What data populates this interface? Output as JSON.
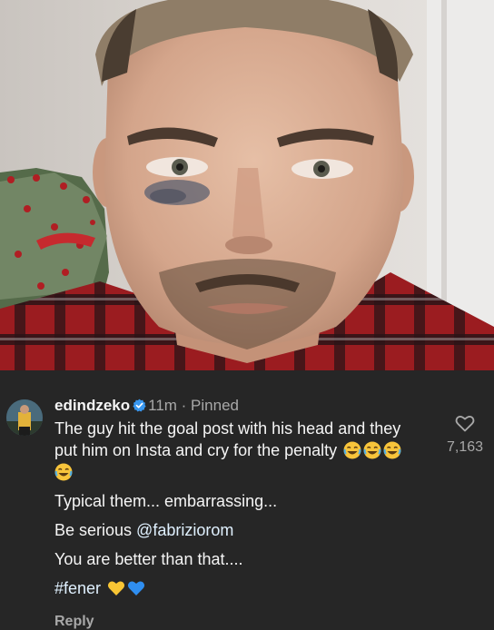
{
  "photo": {
    "alt_icon": "portrait-photo"
  },
  "comment": {
    "username": "edindzeko",
    "verified_icon": "verified-badge-icon",
    "time": "11m",
    "separator": " · ",
    "pinned": "Pinned",
    "line1": "The guy hit the goal post with his head and they",
    "line2": "put him on Insta and cry for the penalty",
    "line2_emoji": [
      "face-with-tears-of-joy",
      "face-with-tears-of-joy",
      "face-with-tears-of-joy"
    ],
    "line3_emoji": [
      "face-with-tears-of-joy"
    ],
    "line4": "Typical them... embarrassing...",
    "line5_prefix": "Be serious ",
    "line5_mention": "@fabriziorom",
    "line6": "You are better than that....",
    "hashtag": "#fener",
    "hashtag_emoji": [
      "yellow-heart",
      "blue-heart"
    ],
    "reply_label": "Reply",
    "like_count": "7,163",
    "like_icon": "heart-outline-icon"
  },
  "colors": {
    "background": "#262626",
    "text": "#f5f5f5",
    "muted": "#a8a8a8",
    "verified": "#3897f0",
    "link": "#e0f1ff"
  }
}
